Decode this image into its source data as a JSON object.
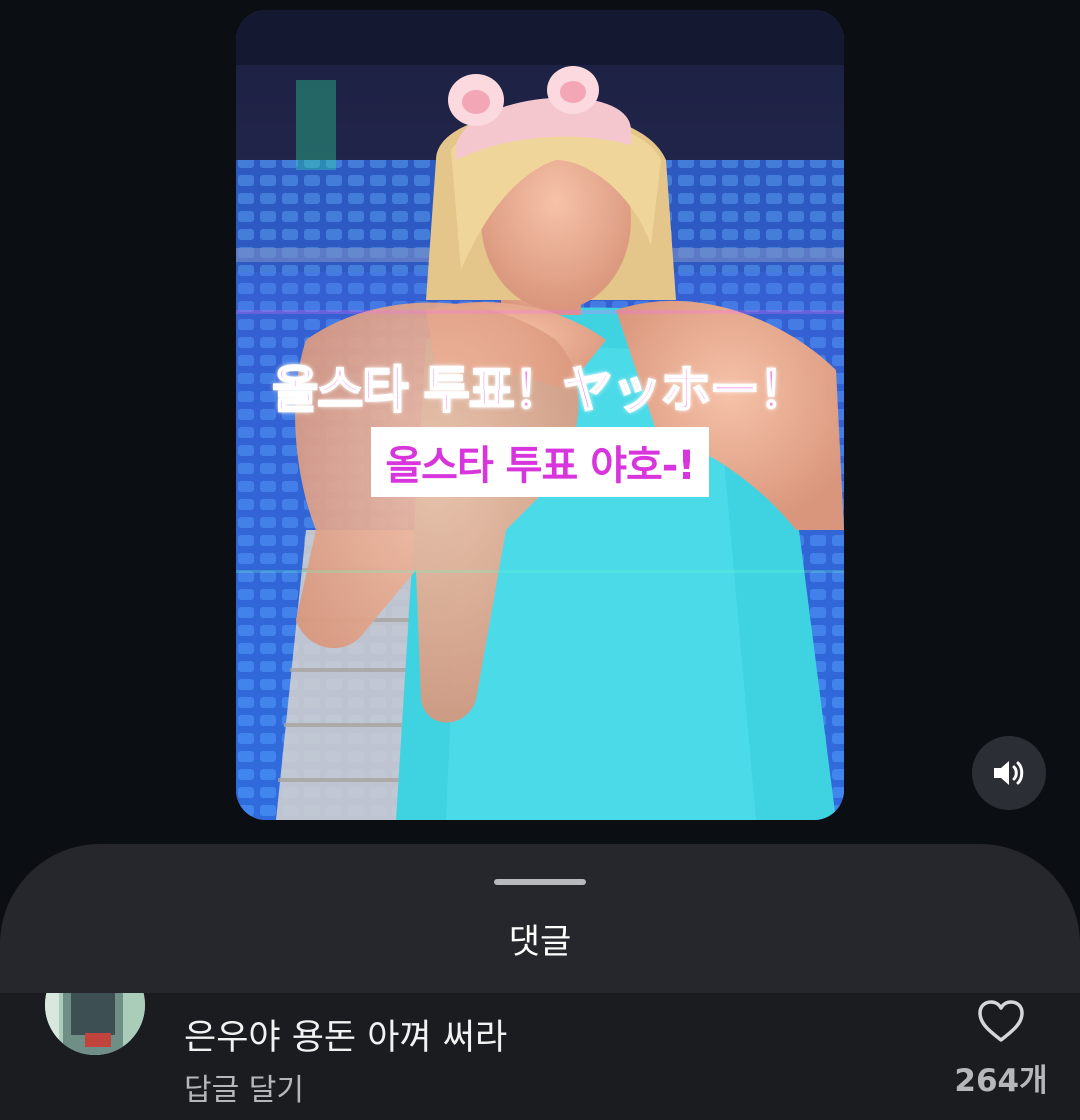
{
  "video": {
    "caption_top": "올스타 투표！ヤッホー！",
    "caption_bottom": "올스타 투표 야호-!",
    "sound_icon": "speaker-volume-icon"
  },
  "comments_sheet": {
    "title": "댓글",
    "comment": {
      "text": "은우야 용돈 아껴 써라",
      "reply_label": "답글 달기",
      "like_icon": "heart-outline-icon",
      "like_count": "264개"
    }
  }
}
